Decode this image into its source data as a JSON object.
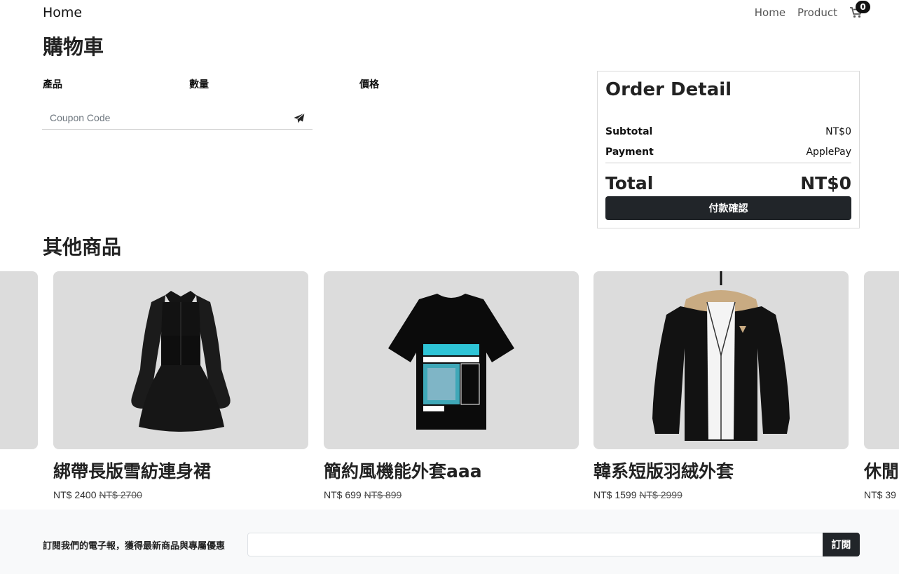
{
  "navbar": {
    "brand": "Home",
    "links": [
      "Home",
      "Product"
    ],
    "cart_count": "0"
  },
  "cart": {
    "title": "購物車",
    "headers": [
      "產品",
      "數量",
      "價格"
    ],
    "coupon_placeholder": "Coupon Code"
  },
  "order": {
    "title": "Order Detail",
    "subtotal_label": "Subtotal",
    "subtotal_value": "NT$0",
    "payment_label": "Payment",
    "payment_value": "ApplePay",
    "total_label": "Total",
    "total_value": "NT$0",
    "pay_button": "付款確認"
  },
  "other_products": {
    "title": "其他商品",
    "items": [
      {
        "name": "綁帶長版雪紡連身裙",
        "price": "NT$ 2400",
        "original": "NT$ 2700",
        "image": "black-dress"
      },
      {
        "name": "簡約風機能外套aaa",
        "price": "NT$ 699",
        "original": "NT$ 899",
        "image": "tokyo-tshirt"
      },
      {
        "name": "韓系短版羽絨外套",
        "price": "NT$ 1599",
        "original": "NT$ 2999",
        "image": "hooded-jacket"
      },
      {
        "name": "休閒",
        "price": "NT$ 39",
        "original": ""
      }
    ]
  },
  "newsletter": {
    "label": "訂閱我們的電子報，獲得最新商品與專屬優惠",
    "button": "訂閱"
  },
  "colors": {
    "dark": "#212529",
    "card_bg": "#dcdcdc",
    "footer_bg": "#f8f9fa",
    "tshirt_accent": "#2ec4d6"
  }
}
